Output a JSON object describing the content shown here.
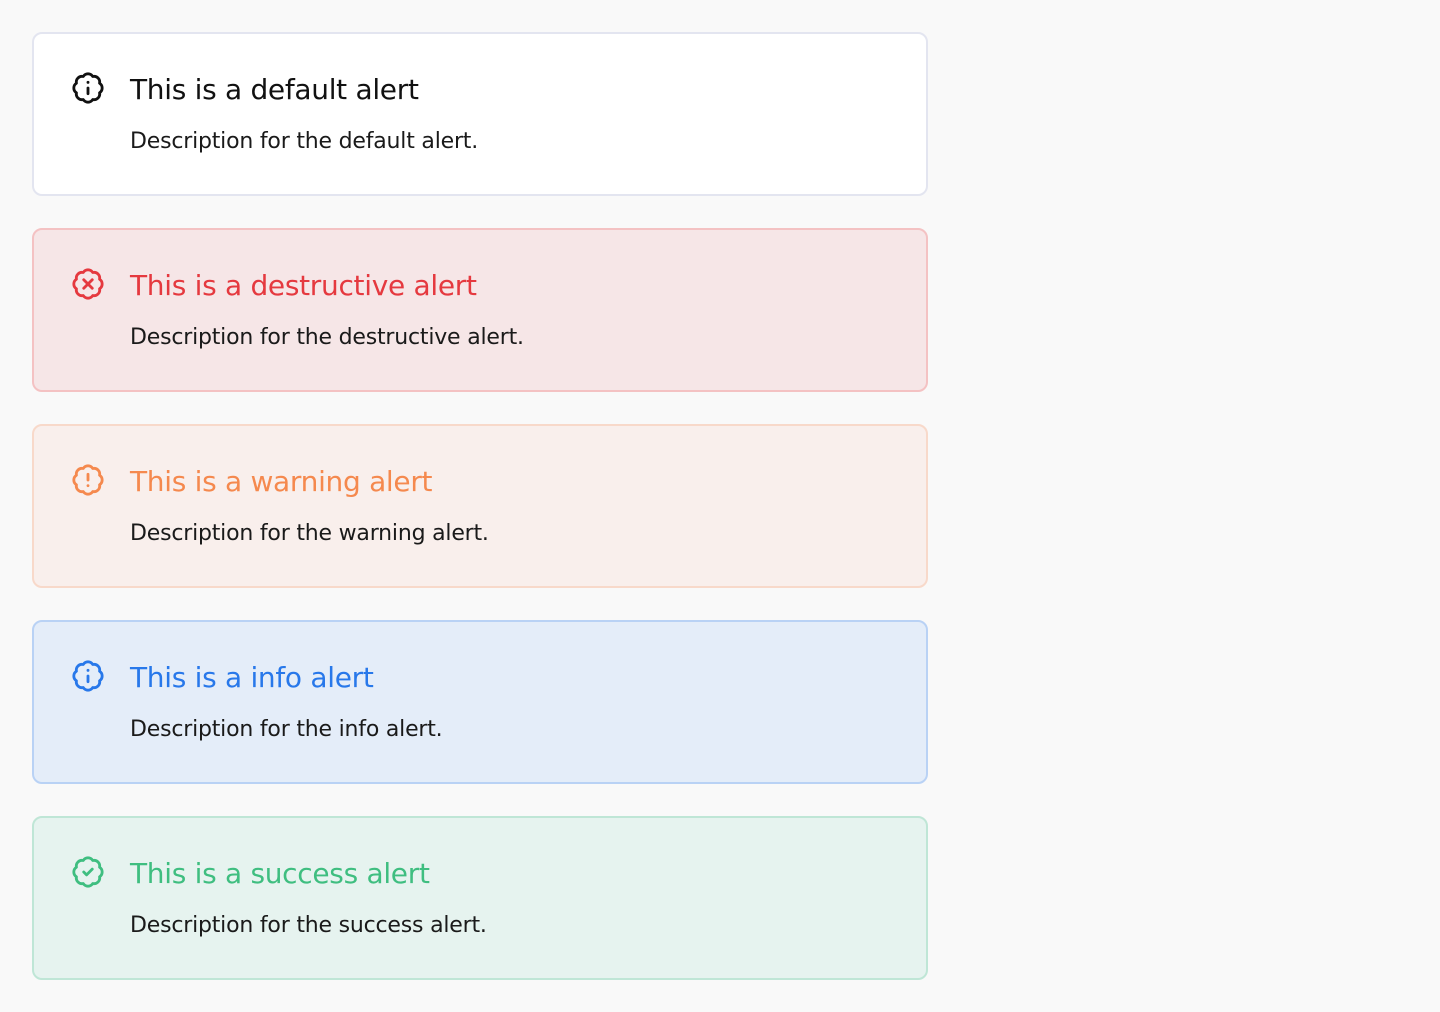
{
  "alerts": [
    {
      "variant": "default",
      "icon": "info-badge-icon",
      "color": "#111111",
      "title": "This is a default alert",
      "description": "Description for the default alert."
    },
    {
      "variant": "destructive",
      "icon": "x-badge-icon",
      "color": "#e5393f",
      "title": "This is a destructive alert",
      "description": "Description for the destructive alert."
    },
    {
      "variant": "warning",
      "icon": "alert-badge-icon",
      "color": "#f5894e",
      "title": "This is a warning alert",
      "description": "Description for the warning alert."
    },
    {
      "variant": "info",
      "icon": "info-badge-icon",
      "color": "#2878ea",
      "title": "This is a info alert",
      "description": "Description for the info alert."
    },
    {
      "variant": "success",
      "icon": "check-badge-icon",
      "color": "#3fbe80",
      "title": "This is a success alert",
      "description": "Description for the success alert."
    }
  ]
}
